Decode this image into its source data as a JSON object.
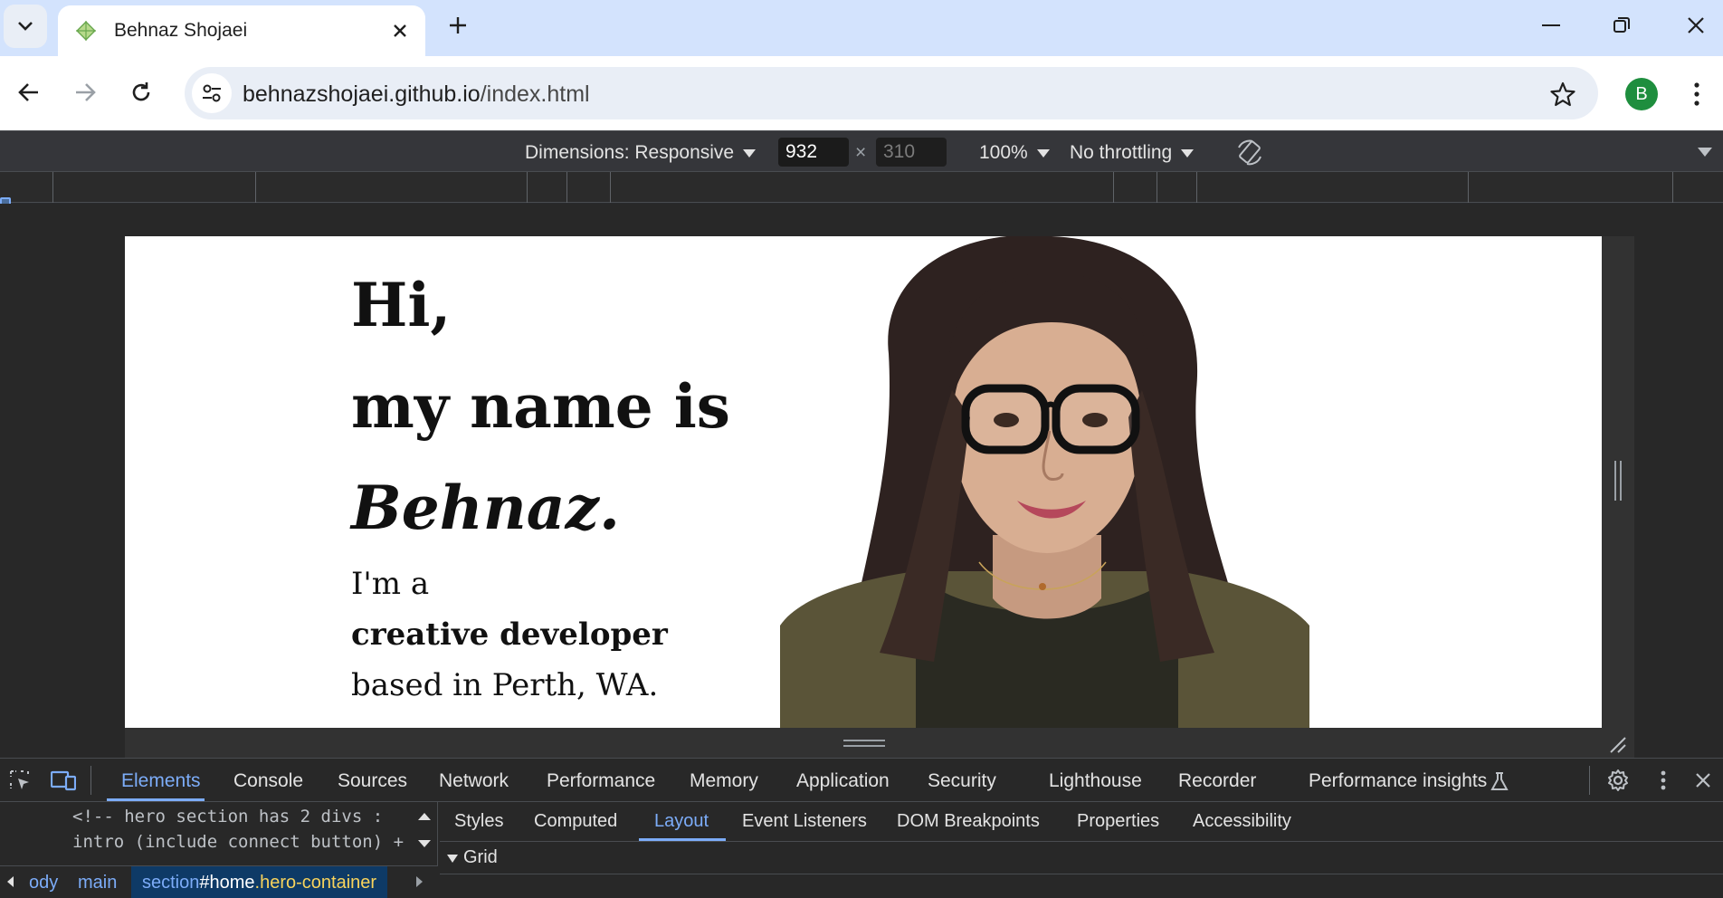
{
  "browser": {
    "tab_title": "Behnaz Shojaei",
    "url_host": "behnazshojaei.github.io",
    "url_path": "/index.html",
    "profile_initial": "B"
  },
  "device_toolbar": {
    "dimensions_label": "Dimensions: Responsive",
    "width": "932",
    "height": "310",
    "times": "×",
    "zoom": "100%",
    "throttling": "No throttling"
  },
  "hero": {
    "greeting": "Hi,",
    "name_intro": "my name is",
    "name": "Behnaz.",
    "tagline_1": "I'm a",
    "tagline_2": "creative developer",
    "tagline_3": "based in Perth, WA."
  },
  "devtools": {
    "tabs": [
      "Elements",
      "Console",
      "Sources",
      "Network",
      "Performance",
      "Memory",
      "Application",
      "Security",
      "Lighthouse",
      "Recorder",
      "Performance insights"
    ],
    "active_tab": "Elements",
    "code_line_1": "<!-- hero section has 2 divs :",
    "code_line_2": "intro (include connect button) +",
    "breadcrumbs": {
      "body": "ody",
      "main": "main",
      "selected_tag": "section",
      "selected_id": "#home",
      "selected_class": ".hero-container"
    },
    "side_tabs": [
      "Styles",
      "Computed",
      "Layout",
      "Event Listeners",
      "DOM Breakpoints",
      "Properties",
      "Accessibility"
    ],
    "active_side_tab": "Layout",
    "section_title": "Grid"
  },
  "colors": {
    "accent": "#7cacf8",
    "tabstrip": "#d3e3fd",
    "avatar": "#1e8e3e",
    "devtools_bg": "#282828"
  }
}
